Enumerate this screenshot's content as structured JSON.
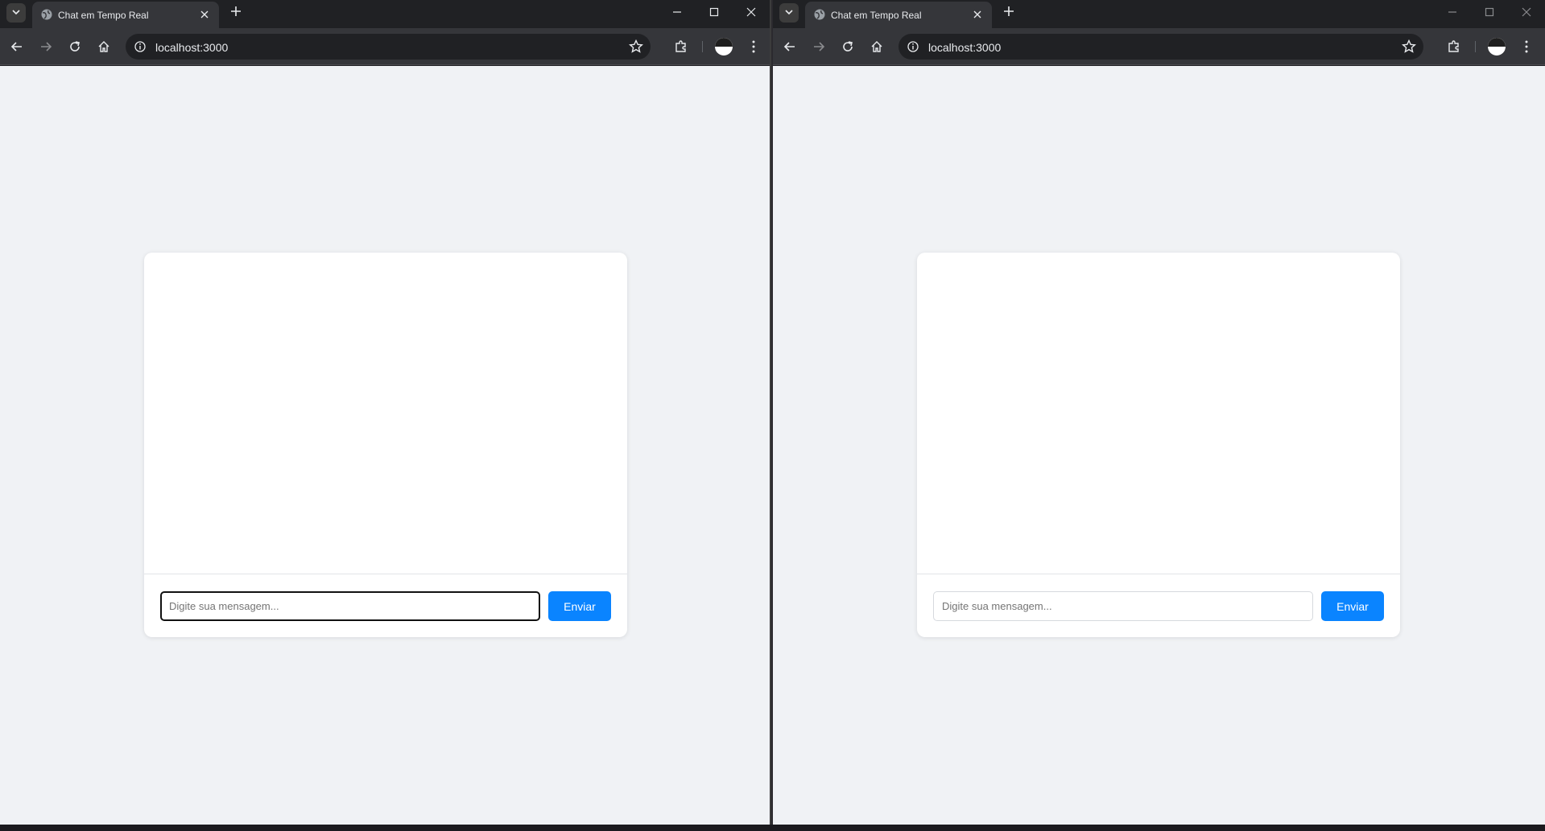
{
  "windows": [
    {
      "tab": {
        "title": "Chat em Tempo Real",
        "favicon": "globe-icon"
      },
      "address": {
        "url": "localhost:3000"
      },
      "chat": {
        "placeholder": "Digite sua mensagem...",
        "send_label": "Enviar",
        "input_focused": true
      }
    },
    {
      "tab": {
        "title": "Chat em Tempo Real",
        "favicon": "globe-icon"
      },
      "address": {
        "url": "localhost:3000"
      },
      "chat": {
        "placeholder": "Digite sua mensagem...",
        "send_label": "Enviar",
        "input_focused": false
      }
    }
  ],
  "colors": {
    "page_background": "#f0f2f5",
    "send_button": "#0a84ff",
    "browser_frame": "#202124",
    "toolbar": "#35363a"
  }
}
